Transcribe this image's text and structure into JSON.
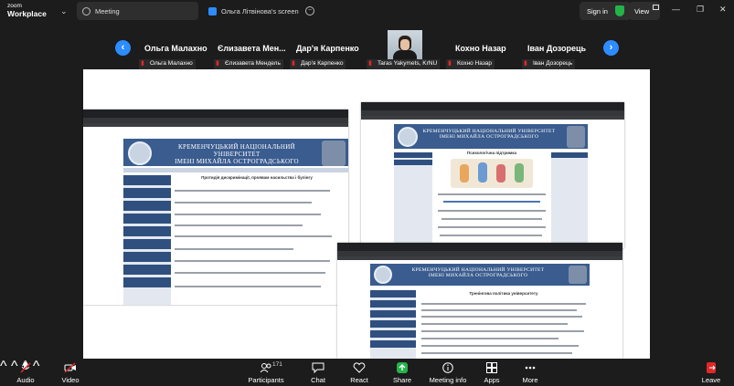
{
  "app": {
    "brand_line1": "zoom",
    "brand_line2": "Workplace"
  },
  "tabs": [
    {
      "label": "Meeting"
    },
    {
      "label": "Ольга Літвінова's screen"
    }
  ],
  "header": {
    "signin_label": "Sign in",
    "view_label": "View"
  },
  "participants_strip": {
    "tiles": [
      {
        "name": "Ольга Малахно",
        "label": "Ольга Малахно"
      },
      {
        "name": "Єлизавета  Мен...",
        "label": "Єлизавета Мендель"
      },
      {
        "name": "Дар'я Карпенко",
        "label": "Дар'я Карпенко"
      },
      {
        "name": "",
        "label": "Taras Yakymets, KrNU"
      },
      {
        "name": "Кохно Назар",
        "label": "Кохно Назар"
      },
      {
        "name": "Іван Дозорець",
        "label": "Іван Дозорець"
      }
    ]
  },
  "shared_screen": {
    "banner_line1": "КРЕМЕНЧУЦЬКИЙ НАЦІОНАЛЬНИЙ УНІВЕРСИТЕТ",
    "banner_line2": "ІМЕНІ МИХАЙЛА ОСТРОГРАДСЬКОГО",
    "win1_heading": "Протидія дискримінації, проявам насильства і булінгу",
    "win2_heading": "Психологічна підтримка",
    "win3_heading": "Тренінгова політика університету"
  },
  "toolbar": {
    "items": [
      {
        "label": "Audio",
        "icon": "mic-muted-icon"
      },
      {
        "label": "Video",
        "icon": "video-off-icon"
      },
      {
        "label": "Participants",
        "icon": "participants-icon",
        "count": "171"
      },
      {
        "label": "Chat",
        "icon": "chat-icon"
      },
      {
        "label": "React",
        "icon": "heart-icon"
      },
      {
        "label": "Share",
        "icon": "share-icon"
      },
      {
        "label": "Meeting info",
        "icon": "info-icon"
      },
      {
        "label": "Apps",
        "icon": "apps-icon"
      },
      {
        "label": "More",
        "icon": "more-icon"
      },
      {
        "label": "Leave",
        "icon": "leave-icon"
      }
    ]
  },
  "colors": {
    "accent": "#2d8cff",
    "share": "#23b34a",
    "danger": "#e02828",
    "background": "#1c1c1c"
  }
}
